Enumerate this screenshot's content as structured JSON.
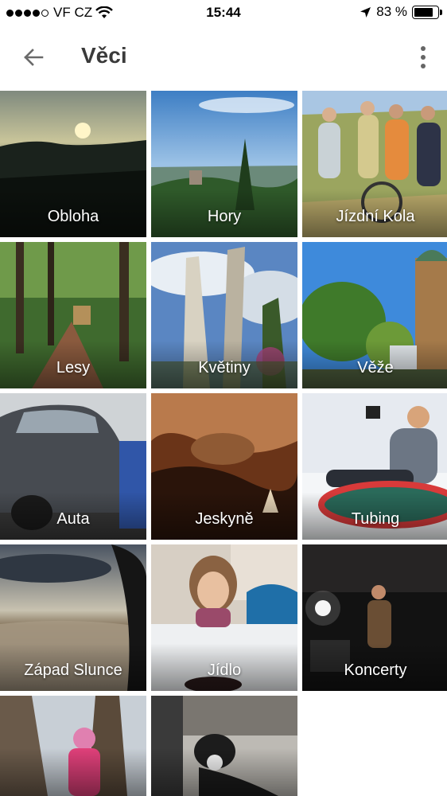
{
  "status_bar": {
    "carrier": "VF CZ",
    "signal_bars_filled": 4,
    "signal_bars_total": 5,
    "time": "15:44",
    "battery_percent_text": "83 %",
    "battery_level": 0.83
  },
  "app_bar": {
    "back_icon": "arrow-back-icon",
    "title": "Věci",
    "menu_icon": "more-vert-icon"
  },
  "categories": [
    {
      "label": "Obloha"
    },
    {
      "label": "Hory"
    },
    {
      "label": "Jízdní Kola"
    },
    {
      "label": "Lesy"
    },
    {
      "label": "Květiny"
    },
    {
      "label": "Věže"
    },
    {
      "label": "Auta"
    },
    {
      "label": "Jeskyně"
    },
    {
      "label": "Tubing"
    },
    {
      "label": "Západ Slunce"
    },
    {
      "label": "Jídlo"
    },
    {
      "label": "Koncerty"
    },
    {
      "label": ""
    },
    {
      "label": ""
    }
  ]
}
